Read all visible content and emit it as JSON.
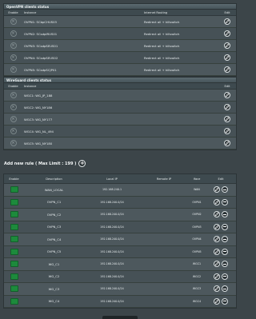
{
  "openvpn": {
    "title": "OpenVPN clients status",
    "headers": {
      "enable": "Enable",
      "instance": "Instance",
      "routing": "Internet Routing",
      "edit": "Edit"
    },
    "rows": [
      {
        "instance": "OVPN1: SCbpCHUS03",
        "routing": "Redirect all + killswitch"
      },
      {
        "instance": "OVPN2: SCsdpIRUS01",
        "routing": "Redirect all + killswitch"
      },
      {
        "instance": "OVPN3: SCsdpSEUS01",
        "routing": "Redirect all + killswitch"
      },
      {
        "instance": "OVPN4: SCsdpSEUS02",
        "routing": "Redirect all + killswitch"
      },
      {
        "instance": "OVPN5: SCsdpSCJP01",
        "routing": "Redirect all + killswitch"
      }
    ]
  },
  "wireguard": {
    "title": "WireGuard clients status",
    "headers": {
      "enable": "Enable",
      "instance": "Instance",
      "edit": "Edit"
    },
    "rows": [
      {
        "instance": "WGC1: WG_JP_188"
      },
      {
        "instance": "WGC2: WG_NY186"
      },
      {
        "instance": "WGC3: WG_NY177"
      },
      {
        "instance": "WGC4: WG_NL_494"
      },
      {
        "instance": "WGC5: WG_NY180"
      }
    ]
  },
  "add_rule": {
    "label": "Add new rule ( Max Limit : 199 )",
    "plus_icon": "plus-circle-icon"
  },
  "rules": {
    "headers": {
      "enable": "Enable",
      "description": "Description",
      "local_ip": "Local IP",
      "remote_ip": "Remote IP",
      "iface": "Iface",
      "edit": "Edit"
    },
    "rows": [
      {
        "description": "WAN_LOCAL",
        "local_ip": "192.168.240.1",
        "remote_ip": "",
        "iface": "WAN"
      },
      {
        "description": "OVPN_C1",
        "local_ip": "192.168.240.0/24",
        "remote_ip": "",
        "iface": "OVPN1"
      },
      {
        "description": "OVPN_C2",
        "local_ip": "192.168.240.0/24",
        "remote_ip": "",
        "iface": "OVPN2"
      },
      {
        "description": "OVPN_C3",
        "local_ip": "192.168.240.0/24",
        "remote_ip": "",
        "iface": "OVPN3"
      },
      {
        "description": "OVPN_C4",
        "local_ip": "192.168.240.0/24",
        "remote_ip": "",
        "iface": "OVPN4"
      },
      {
        "description": "OVPN_C5",
        "local_ip": "192.168.240.0/24",
        "remote_ip": "",
        "iface": "OVPN5"
      },
      {
        "description": "WG_C1",
        "local_ip": "192.168.240.0/24",
        "remote_ip": "",
        "iface": "WGC1"
      },
      {
        "description": "WG_C2",
        "local_ip": "192.168.240.0/24",
        "remote_ip": "",
        "iface": "WGC2"
      },
      {
        "description": "WG_C3",
        "local_ip": "192.168.240.0/24",
        "remote_ip": "",
        "iface": "WGC3"
      },
      {
        "description": "WG_C4",
        "local_ip": "192.168.240.0/24",
        "remote_ip": "",
        "iface": "WGC4"
      }
    ]
  },
  "colors": {
    "accent_green": "#1d8a3c",
    "panel_bg": "#4a5559",
    "page_bg": "#3c4549"
  }
}
